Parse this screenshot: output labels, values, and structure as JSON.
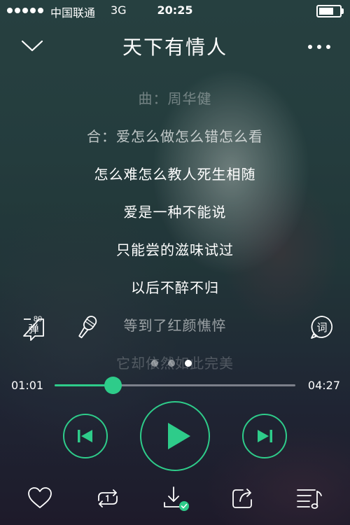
{
  "status_bar": {
    "carrier": "中国联通",
    "network": "3G",
    "time": "20:25",
    "battery_level": 0.75
  },
  "player": {
    "title": "天下有情人",
    "lyrics": [
      "曲：周华健",
      "合：爱怎么做怎么错怎么看",
      "怎么难怎么教人死生相随",
      "爱是一种不能说",
      "只能尝的滋味试过",
      "以后不醉不归",
      "等到了红颜憔悴",
      "它却依然如此完美"
    ],
    "danmu": {
      "label": "弹",
      "count": "80"
    },
    "lyric_button_label": "词",
    "page_dots": {
      "count": 3,
      "active": 2
    },
    "progress": {
      "current": "01:01",
      "total": "04:27",
      "fraction": 0.24
    }
  },
  "icons": {
    "collapse": "chevron-down-icon",
    "more": "more-dots-icon",
    "mic": "microphone-icon",
    "prev": "previous-track-icon",
    "play": "play-icon",
    "next": "next-track-icon",
    "favorite": "heart-icon",
    "repeat": "repeat-one-icon",
    "download": "download-icon",
    "share": "share-icon",
    "playlist": "playlist-icon"
  },
  "colors": {
    "accent": "#2ecc8a",
    "text": "#ffffff"
  }
}
